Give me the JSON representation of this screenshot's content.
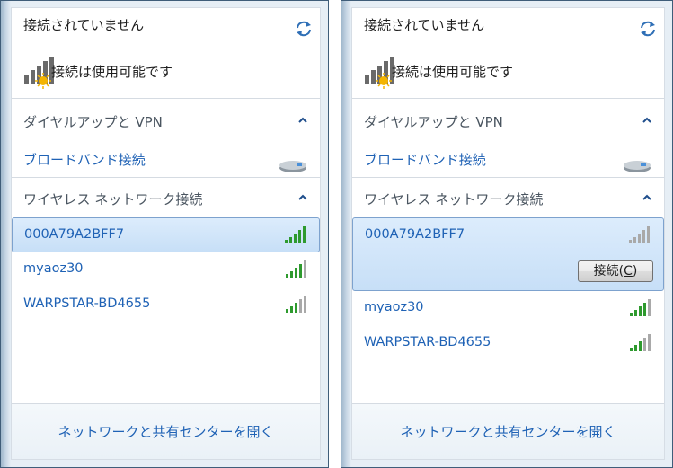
{
  "colors": {
    "link": "#1f62b5",
    "signal_active": "#2e9a2e",
    "signal_inactive": "#a9a9a9",
    "selected_background": "#cfe3f8"
  },
  "panels": [
    {
      "status_title": "接続されていません",
      "availability_text": "接続は使用可能です",
      "dialup_group": {
        "label": "ダイヤルアップと VPN",
        "items": [
          "ブロードバンド接続"
        ]
      },
      "wireless_group": {
        "label": "ワイヤレス ネットワーク接続",
        "networks": [
          {
            "ssid": "000A79A2BFF7",
            "signal_bars": 5,
            "selected": true
          },
          {
            "ssid": "myaoz30",
            "signal_bars": 4,
            "selected": false
          },
          {
            "ssid": "WARPSTAR-BD4655",
            "signal_bars": 3,
            "selected": false
          }
        ]
      },
      "footer_link": "ネットワークと共有センターを開く",
      "icons": {
        "refresh": "refresh-icon",
        "availability": "network-available-icon",
        "broadband": "broadband-modem-icon"
      }
    },
    {
      "status_title": "接続されていません",
      "availability_text": "接続は使用可能です",
      "dialup_group": {
        "label": "ダイヤルアップと VPN",
        "items": [
          "ブロードバンド接続"
        ]
      },
      "wireless_group": {
        "label": "ワイヤレス ネットワーク接続",
        "networks": [
          {
            "ssid": "000A79A2BFF7",
            "signal_bars": 0,
            "selected": true,
            "connect_button": {
              "label": "接続",
              "accel": "C"
            }
          },
          {
            "ssid": "myaoz30",
            "signal_bars": 4,
            "selected": false
          },
          {
            "ssid": "WARPSTAR-BD4655",
            "signal_bars": 3,
            "selected": false
          }
        ]
      },
      "footer_link": "ネットワークと共有センターを開く",
      "icons": {
        "refresh": "refresh-icon",
        "availability": "network-available-icon",
        "broadband": "broadband-modem-icon"
      }
    }
  ]
}
